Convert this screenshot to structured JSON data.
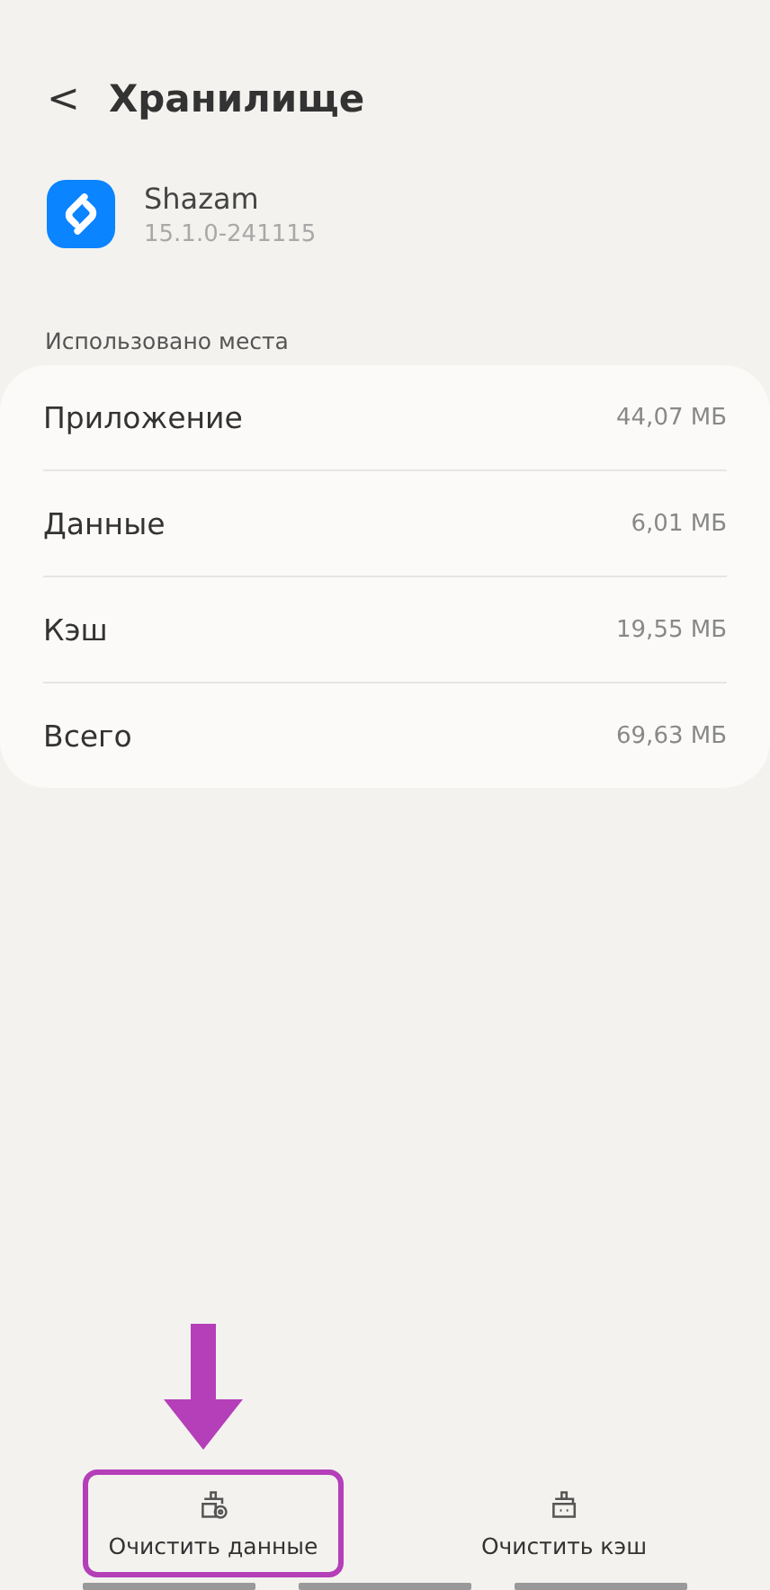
{
  "header": {
    "back": "<",
    "title": "Хранилище"
  },
  "app": {
    "name": "Shazam",
    "version": "15.1.0-241115"
  },
  "section_label": "Использовано места",
  "rows": [
    {
      "label": "Приложение",
      "value": "44,07 МБ"
    },
    {
      "label": "Данные",
      "value": "6,01 МБ"
    },
    {
      "label": "Кэш",
      "value": "19,55 МБ"
    },
    {
      "label": "Всего",
      "value": "69,63 МБ"
    }
  ],
  "actions": [
    {
      "kind": "data",
      "label": "Очистить данные",
      "highlighted": true
    },
    {
      "kind": "cache",
      "label": "Очистить кэш",
      "highlighted": false
    }
  ]
}
